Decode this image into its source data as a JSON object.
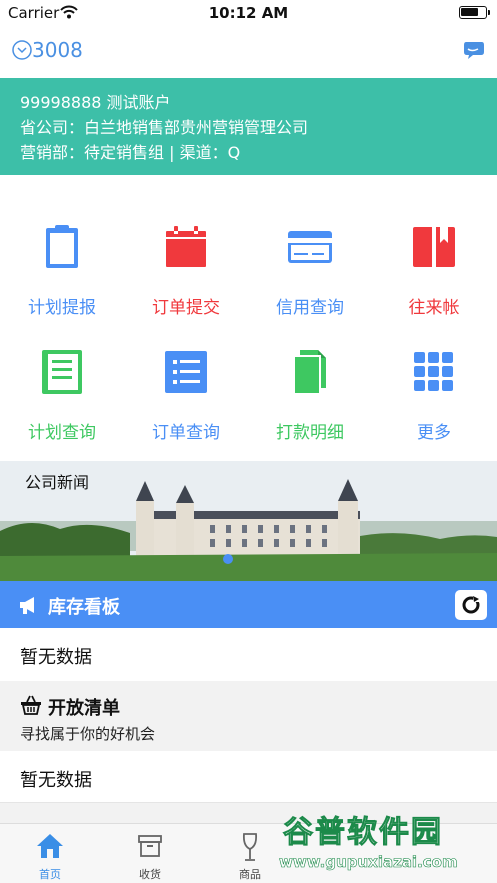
{
  "status_bar": {
    "carrier": "Carrier",
    "time": "10:12 AM"
  },
  "navbar": {
    "code": "3008"
  },
  "account": {
    "line1": "99998888 测试账户",
    "line2": "省公司：白兰地销售部贵州营销管理公司",
    "line3": "营销部：待定销售组 | 渠道：Q"
  },
  "grid": {
    "items": [
      {
        "label": "计划提报",
        "icon": "clipboard-icon",
        "color": "#4a8ff5"
      },
      {
        "label": "订单提交",
        "icon": "calendar-icon",
        "color": "#f0393d"
      },
      {
        "label": "信用查询",
        "icon": "credit-card-icon",
        "color": "#4a8ff5"
      },
      {
        "label": "往来帐",
        "icon": "bookmark-book-icon",
        "color": "#f0393d"
      },
      {
        "label": "计划查询",
        "icon": "notebook-icon",
        "color": "#3ec861"
      },
      {
        "label": "订单查询",
        "icon": "list-icon",
        "color": "#4a8ff5"
      },
      {
        "label": "打款明细",
        "icon": "documents-icon",
        "color": "#3ec861"
      },
      {
        "label": "更多",
        "icon": "grid-dots-icon",
        "color": "#4a8ff5"
      }
    ]
  },
  "news": {
    "title": "公司新闻"
  },
  "inventory": {
    "title": "库存看板",
    "empty": "暂无数据"
  },
  "open_list": {
    "title": "开放清单",
    "subtitle": "寻找属于你的好机会",
    "empty": "暂无数据"
  },
  "tabbar": {
    "tabs": [
      {
        "label": "首页",
        "icon": "home-icon",
        "active": true
      },
      {
        "label": "收货",
        "icon": "box-icon",
        "active": false
      },
      {
        "label": "商品",
        "icon": "wine-glass-icon",
        "active": false
      }
    ]
  },
  "watermark": {
    "top": "谷普软件园",
    "bottom": "www.gupuxiazai.com"
  },
  "colors": {
    "teal": "#3dbfa8",
    "blue": "#4a8ff5",
    "red": "#f0393d",
    "green": "#3ec861"
  }
}
